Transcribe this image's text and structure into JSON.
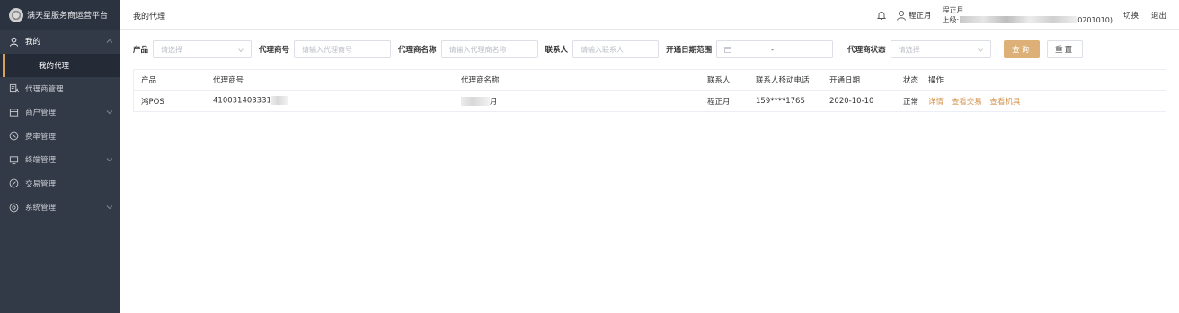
{
  "app": {
    "title": "满天星服务商运营平台"
  },
  "sidebar": {
    "items": [
      {
        "label": "我的",
        "icon": "user-icon",
        "expanded": true
      },
      {
        "label": "代理商管理",
        "icon": "agent-icon"
      },
      {
        "label": "商户管理",
        "icon": "merchant-icon",
        "has_children": true
      },
      {
        "label": "费率管理",
        "icon": "rate-icon"
      },
      {
        "label": "终端管理",
        "icon": "terminal-icon",
        "has_children": true
      },
      {
        "label": "交易管理",
        "icon": "transaction-icon"
      },
      {
        "label": "系统管理",
        "icon": "settings-icon",
        "has_children": true
      }
    ],
    "sub_items": [
      {
        "label": "我的代理",
        "active": true
      }
    ]
  },
  "header": {
    "page_title": "我的代理",
    "user_name": "程正月",
    "user_block_name": "程正月",
    "parent_prefix": "上级:",
    "parent_suffix": "0201010)",
    "switch_label": "切换",
    "logout_label": "退出"
  },
  "filters": {
    "product_label": "产品",
    "product_placeholder": "请选择",
    "agent_no_label": "代理商号",
    "agent_no_placeholder": "请输入代理商号",
    "agent_name_label": "代理商名称",
    "agent_name_placeholder": "请输入代理商名称",
    "contact_label": "联系人",
    "contact_placeholder": "请输入联系人",
    "date_range_label": "开通日期范围",
    "date_range_separator": "-",
    "status_label": "代理商状态",
    "status_placeholder": "请选择",
    "query_button": "查询",
    "reset_button": "重置"
  },
  "table": {
    "columns": [
      "产品",
      "代理商号",
      "代理商名称",
      "联系人",
      "联系人移动电话",
      "开通日期",
      "状态",
      "操作"
    ],
    "rows": [
      {
        "product": "鸿POS",
        "agent_no": "410031403331",
        "agent_name_tail": "月",
        "contact": "程正月",
        "phone": "159****1765",
        "open_date": "2020-10-10",
        "status": "正常",
        "actions": [
          "详情",
          "查看交易",
          "查看机具"
        ]
      }
    ]
  },
  "colors": {
    "sidebar_bg": "#333a47",
    "accent": "#ddb077",
    "link": "#d4934c"
  }
}
